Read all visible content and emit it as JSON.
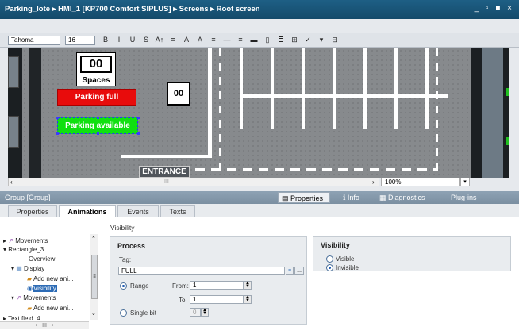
{
  "window": {
    "breadcrumb": "Parking_lote ▸ HMI_1 [KP700 Comfort SIPLUS] ▸ Screens ▸ Root screen",
    "controls": "_ ▫ ■ ×"
  },
  "toolbar": {
    "font": "Tahoma",
    "size": "16",
    "buttons": [
      "B",
      "I",
      "U",
      "S",
      "A↑",
      "≡",
      "A",
      "A",
      "≡",
      "—",
      "≡",
      "▬",
      "▯",
      "≣",
      "⊞",
      "✓",
      "▾",
      "⊟"
    ]
  },
  "screen": {
    "spaces_value": "00",
    "spaces_label": "Spaces",
    "parking_full_label": "Parking full",
    "parking_available_label": "Parking available",
    "counter_value": "00",
    "entrance_label": "ENTRANCE"
  },
  "zoom": "100%",
  "inspector": {
    "title": "Group [Group]",
    "tabs": [
      "Properties",
      "Info",
      "Diagnostics",
      "Plug-ins"
    ],
    "subtabs": [
      "Properties",
      "Animations",
      "Events",
      "Texts"
    ]
  },
  "tree": [
    {
      "label": "Movements",
      "indent": 1,
      "selected": false
    },
    {
      "label": "Rectangle_3",
      "indent": 0,
      "selected": false
    },
    {
      "label": "Overview",
      "indent": 2,
      "selected": false
    },
    {
      "label": "Display",
      "indent": 1,
      "selected": false
    },
    {
      "label": "Add new ani...",
      "indent": 3,
      "selected": false
    },
    {
      "label": "Visibility",
      "indent": 3,
      "selected": true
    },
    {
      "label": "Movements",
      "indent": 1,
      "selected": false
    },
    {
      "label": "Add new ani...",
      "indent": 3,
      "selected": false
    },
    {
      "label": "Text field_4",
      "indent": 0,
      "selected": false
    }
  ],
  "panel": {
    "section": "Visibility",
    "process": {
      "title": "Process",
      "tag_label": "Tag:",
      "tag_value": "FULL",
      "range_label": "Range",
      "from_label": "From:",
      "from_value": "1",
      "to_label": "To:",
      "to_value": "1",
      "single_bit_label": "Single bit",
      "single_bit_value": "0"
    },
    "visibility": {
      "title": "Visibility",
      "visible_label": "Visible",
      "invisible_label": "Invisible",
      "selected": "Invisible"
    }
  }
}
